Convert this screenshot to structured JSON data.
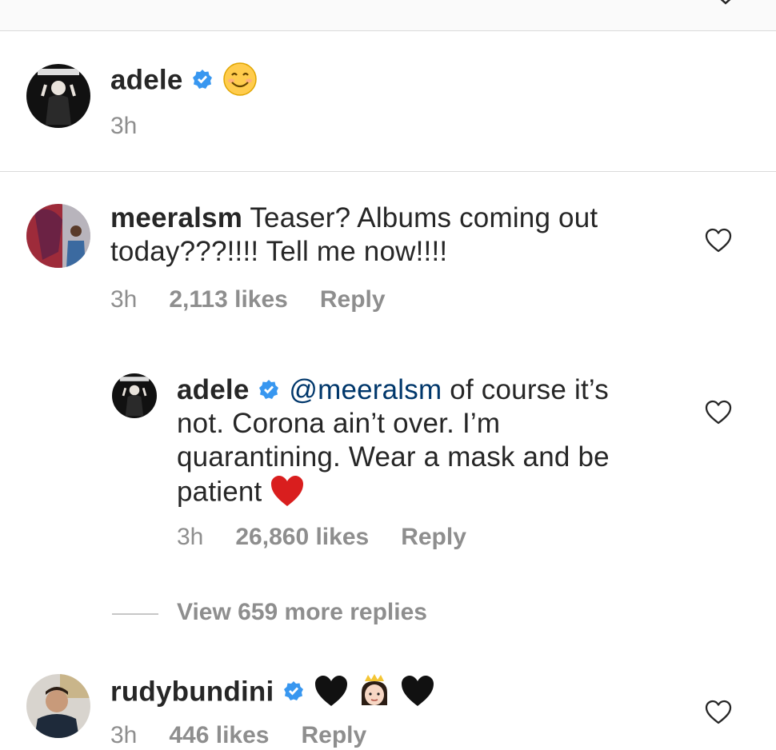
{
  "caption": {
    "username": "adele",
    "text": "",
    "time": "3h"
  },
  "comment1": {
    "username": "meeralsm",
    "text_line1": "Teaser? Albums coming out",
    "text_line2": "today???!!!! Tell me now!!!!",
    "time": "3h",
    "likes": "2,113 likes",
    "reply": "Reply"
  },
  "reply1": {
    "username": "adele",
    "mention": "@meeralsm",
    "text_line1": "of course it’s",
    "text_line2": "not. Corona ain’t over. I’m",
    "text_line3": "quarantining. Wear a mask and be",
    "text_line4": "patient",
    "time": "3h",
    "likes": "26,860 likes",
    "reply": "Reply"
  },
  "view_more": "View 659 more replies",
  "comment2": {
    "username": "rudybundini",
    "time": "3h",
    "likes": "446 likes",
    "reply": "Reply"
  },
  "colors": {
    "verified": "#3897f0",
    "meta_text": "#8e8e8e",
    "mention": "#00376b",
    "heart_emoji": "#d91e1e"
  },
  "icons": [
    "verified-badge-icon",
    "smiling-face-emoji",
    "red-heart-emoji",
    "black-heart-emoji",
    "princess-emoji",
    "like-heart-icon"
  ]
}
